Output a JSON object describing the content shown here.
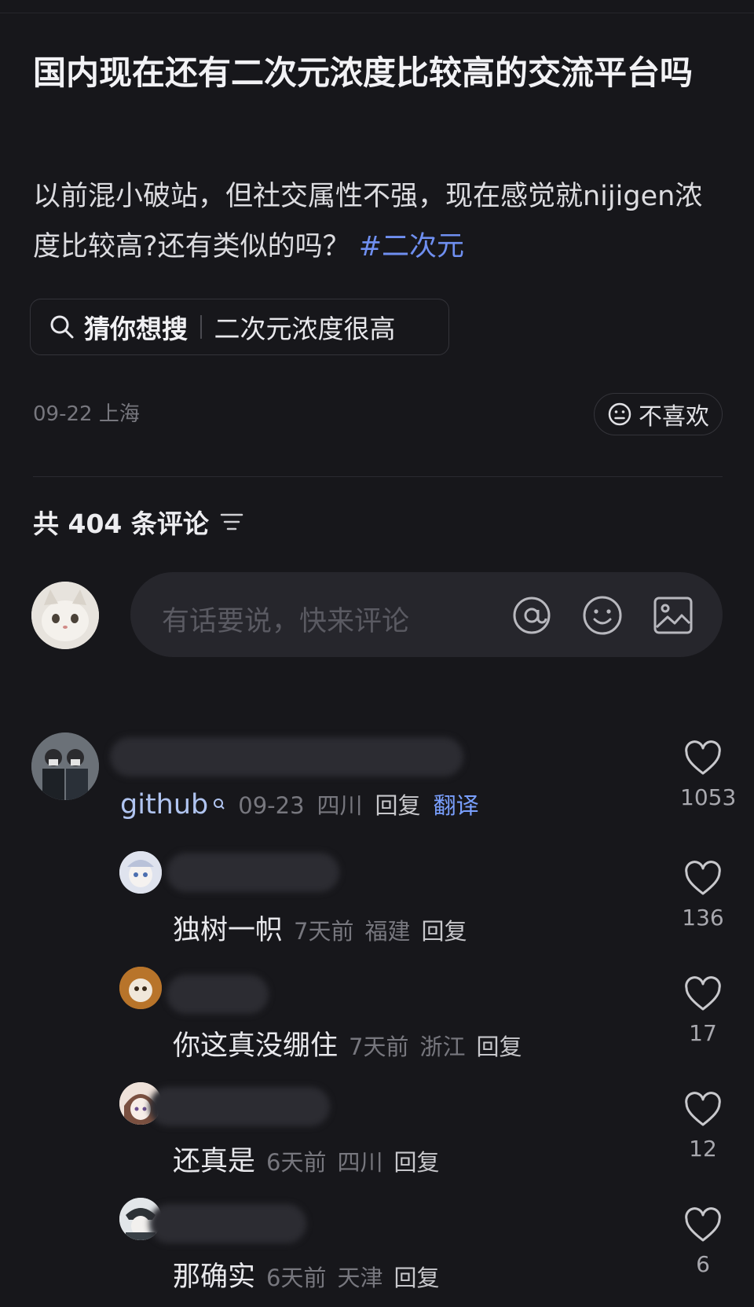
{
  "post": {
    "title": "国内现在还有二次元浓度比较高的交流平台吗",
    "description": "以前混小破站，但社交属性不强，现在感觉就nijigen浓度比较高?还有类似的吗？",
    "hashtag": "#二次元",
    "date": "09-22",
    "location": "上海",
    "dislike_label": "不喜欢"
  },
  "guess_search": {
    "label": "猜你想搜",
    "term": "二次元浓度很高",
    "icon": "search-icon"
  },
  "comments_header": {
    "count_text": "共 404 条评论",
    "sort_icon": "filter-icon"
  },
  "comment_input": {
    "placeholder": "有话要说，快来评论",
    "icons": [
      "at-icon",
      "emoji-icon",
      "image-icon"
    ]
  },
  "comments": [
    {
      "author": "github",
      "date": "09-23",
      "location": "四川",
      "reply_label": "回复",
      "translate_label": "翻译",
      "likes": "1053",
      "replies": [
        {
          "text": "独树一帜",
          "time": "7天前",
          "location": "福建",
          "reply_label": "回复",
          "likes": "136"
        },
        {
          "text": "你这真没绷住",
          "time": "7天前",
          "location": "浙江",
          "reply_label": "回复",
          "likes": "17"
        },
        {
          "text": "还真是",
          "time": "6天前",
          "location": "四川",
          "reply_label": "回复",
          "likes": "12"
        },
        {
          "text": "那确实",
          "time": "6天前",
          "location": "天津",
          "reply_label": "回复",
          "likes": "6"
        }
      ]
    }
  ],
  "colors": {
    "background": "#17171b",
    "hashtag": "#6f8ff0",
    "translate": "#7aa0ff"
  }
}
